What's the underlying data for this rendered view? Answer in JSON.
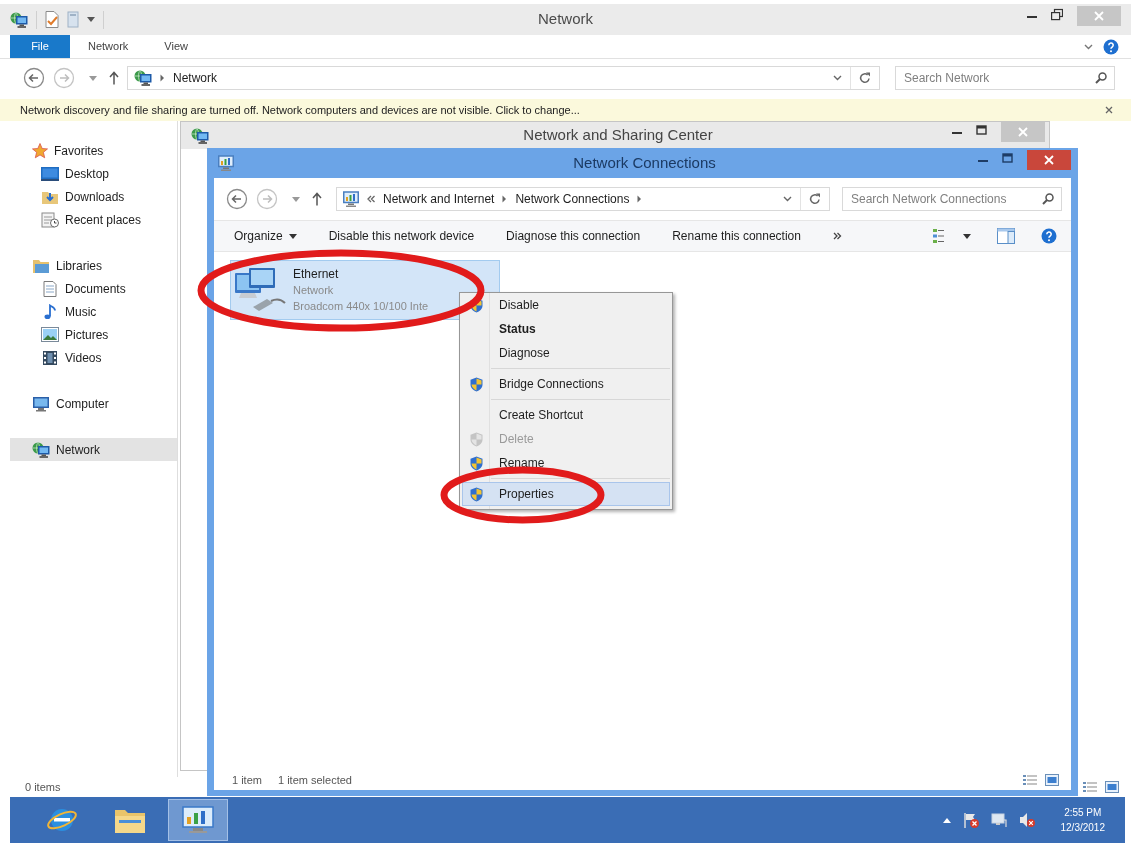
{
  "explorer": {
    "title": "Network",
    "active": false,
    "ribbon_tabs": [
      {
        "label": "File",
        "kind": "file"
      },
      {
        "label": "Network",
        "kind": "tab"
      },
      {
        "label": "View",
        "kind": "tab"
      }
    ],
    "address": {
      "truncated": false,
      "path": [
        "Network"
      ]
    },
    "search": {
      "placeholder": "Search Network"
    },
    "info_bar": {
      "text": "Network discovery and file sharing are turned off. Network computers and devices are not visible. Click to change..."
    },
    "nav_pane": [
      {
        "label": "Favorites",
        "kind": "favorites",
        "selected": false,
        "children": [
          {
            "label": "Desktop",
            "kind": "desktop",
            "selected": false
          },
          {
            "label": "Downloads",
            "kind": "downloads",
            "selected": false
          },
          {
            "label": "Recent places",
            "kind": "recent",
            "selected": false
          }
        ]
      },
      {
        "label": "Libraries",
        "kind": "libraries",
        "selected": false,
        "children": [
          {
            "label": "Documents",
            "kind": "documents",
            "selected": false
          },
          {
            "label": "Music",
            "kind": "music",
            "selected": false
          },
          {
            "label": "Pictures",
            "kind": "pictures",
            "selected": false
          },
          {
            "label": "Videos",
            "kind": "videos",
            "selected": false
          }
        ]
      },
      {
        "label": "Computer",
        "kind": "computer",
        "selected": false
      },
      {
        "label": "Network",
        "kind": "network",
        "selected": true
      }
    ],
    "status_bar": {
      "text": "0 items"
    }
  },
  "sharing_center": {
    "title": "Network and Sharing Center",
    "active": false
  },
  "connections": {
    "title": "Network Connections",
    "active": true,
    "address": {
      "truncated": true,
      "path": [
        "Network and Internet",
        "Network Connections"
      ]
    },
    "search": {
      "placeholder": "Search Network Connections"
    },
    "commands": [
      {
        "label": "Organize",
        "kind": "menu"
      },
      {
        "label": "Disable this network device",
        "kind": "plain"
      },
      {
        "label": "Diagnose this connection",
        "kind": "plain"
      },
      {
        "label": "Rename this connection",
        "kind": "plain"
      }
    ],
    "items": [
      {
        "name": "Ethernet",
        "status": "Network",
        "device": "Broadcom 440x 10/100 Inte",
        "selected": true
      }
    ],
    "status_bar": {
      "count": "1 item",
      "selection": "1 item selected"
    }
  },
  "context_menu": {
    "groups": [
      [
        {
          "label": "Disable",
          "kind": "shield",
          "default": false,
          "disabled": false,
          "selected": false
        },
        {
          "label": "Status",
          "kind": "plain",
          "default": true,
          "disabled": false,
          "selected": false
        },
        {
          "label": "Diagnose",
          "kind": "plain",
          "default": false,
          "disabled": false,
          "selected": false
        }
      ],
      [
        {
          "label": "Bridge Connections",
          "kind": "shield",
          "default": false,
          "disabled": false,
          "selected": false
        }
      ],
      [
        {
          "label": "Create Shortcut",
          "kind": "plain",
          "default": false,
          "disabled": false,
          "selected": false
        },
        {
          "label": "Delete",
          "kind": "shield",
          "default": false,
          "disabled": true,
          "selected": false
        },
        {
          "label": "Rename",
          "kind": "shield",
          "default": false,
          "disabled": false,
          "selected": false
        }
      ],
      [
        {
          "label": "Properties",
          "kind": "shield",
          "default": false,
          "disabled": false,
          "selected": true
        }
      ]
    ]
  },
  "taskbar": {
    "apps": [
      {
        "kind": "browser",
        "selected": false
      },
      {
        "kind": "folder",
        "selected": false
      },
      {
        "kind": "control_panel",
        "selected": true
      }
    ],
    "clock": {
      "time": "2:55 PM",
      "date": "12/3/2012"
    }
  }
}
